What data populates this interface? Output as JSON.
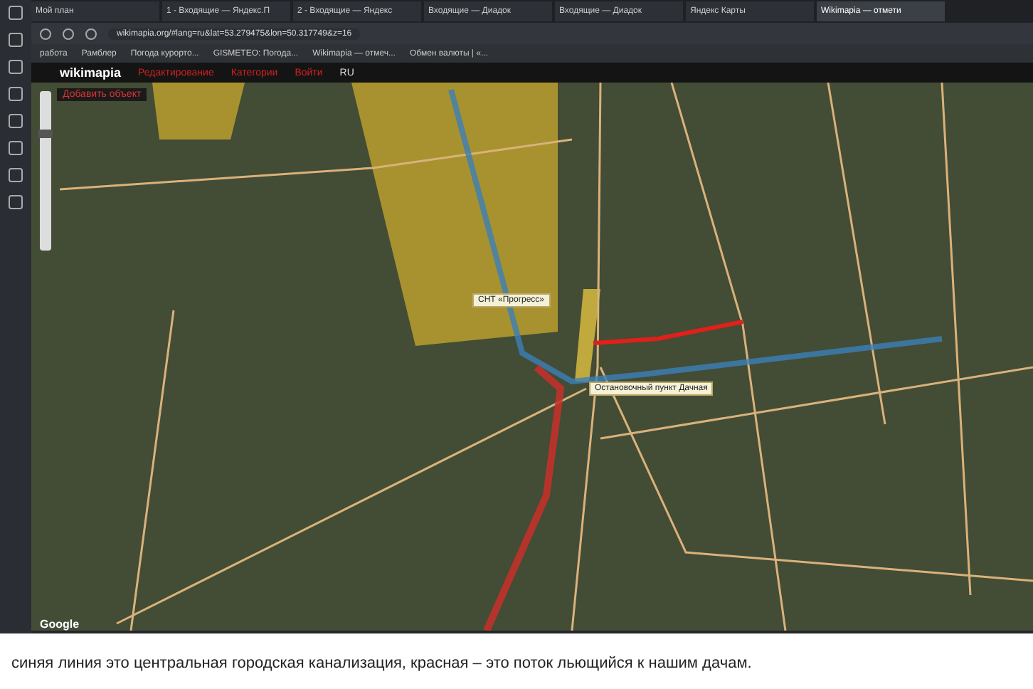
{
  "browser": {
    "tabs": [
      {
        "label": "Мой план",
        "selected": false
      },
      {
        "label": "1 - Входящие — Яндекс.П",
        "selected": false
      },
      {
        "label": "2 - Входящие — Яндекс",
        "selected": false
      },
      {
        "label": "Входящие — Диадок",
        "selected": false
      },
      {
        "label": "Входящие — Диадок",
        "selected": false
      },
      {
        "label": "Яндекс Карты",
        "selected": false
      },
      {
        "label": "Wikimapia — отмети",
        "selected": true
      }
    ],
    "address": "wikimapia.org/#lang=ru&lat=53.279475&lon=50.317749&z=16",
    "bookmarks": [
      "работа",
      "Рамблер",
      "Погода курорто...",
      "GISMETEO: Погода...",
      "Wikimapia — отмеч...",
      "Обмен валюты | «..."
    ]
  },
  "wikimapia": {
    "logo": "wikimapia",
    "menu": [
      "Редактирование",
      "Категории",
      "Войти",
      "RU"
    ],
    "add_object": "Добавить объект"
  },
  "map": {
    "zoom": {
      "level": 0.75
    },
    "labels": [
      "СНТ «Прогресс»",
      "Остановочный пункт Дачная"
    ],
    "attribution": "Google"
  },
  "caption": "синяя линия это центральная городская канализация, красная – это поток льющийся к нашим дачам."
}
